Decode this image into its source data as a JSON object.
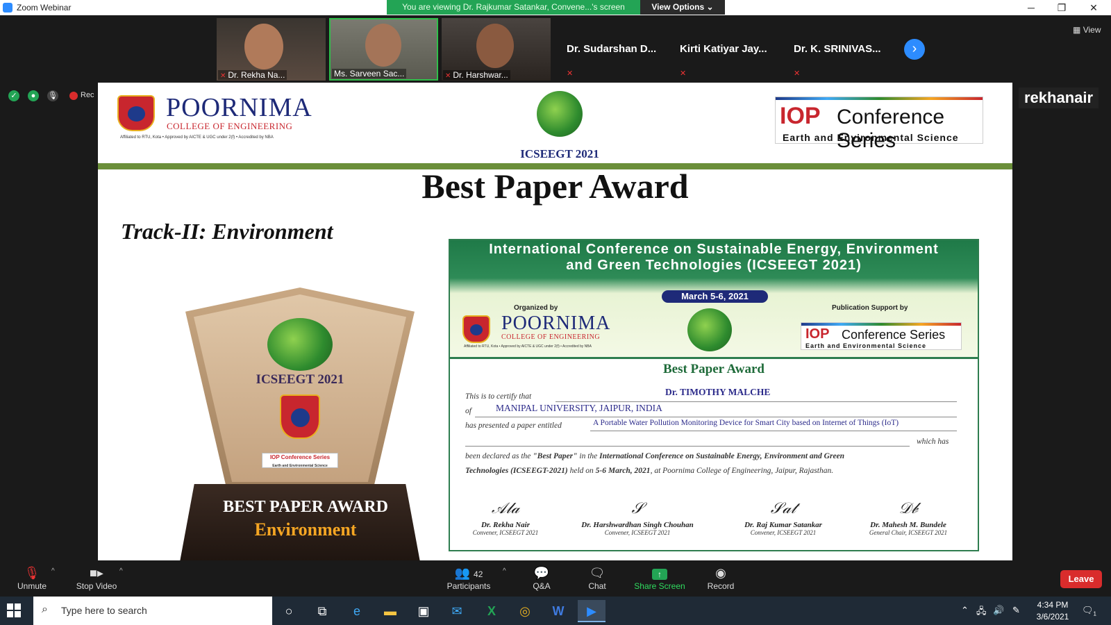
{
  "window": {
    "title": "Zoom Webinar",
    "viewing_banner": "You are viewing Dr. Rajkumar Satankar, Convene...'s screen",
    "view_options": "View Options"
  },
  "participants_strip": {
    "video_tiles": [
      {
        "label": "Dr. Rekha Na..."
      },
      {
        "label": "Ms. Sarveen Sac..."
      },
      {
        "label": "Dr. Harshwar..."
      }
    ],
    "name_tiles": [
      {
        "name": "Dr. Sudarshan D..."
      },
      {
        "name": "Kirti Katiyar Jay..."
      },
      {
        "name": "Dr. K. SRINIVAS..."
      }
    ],
    "view_label": "View"
  },
  "status": {
    "record_label": "Rec"
  },
  "shared_screen": {
    "sharer_name": "rekhanair",
    "header": {
      "college_name": "POORNIMA",
      "college_sub": "COLLEGE OF ENGINEERING",
      "college_aff": "Affiliated to RTU, Kota • Approved by AICTE & UGC under 2(f) • Accredited by NBA",
      "conf_short": "ICSEEGT 2021",
      "iop_big": "IOP",
      "iop_cs": "Conference Series",
      "iop_ees": "Earth and Environmental Science"
    },
    "award_title": "Best Paper Award",
    "track": "Track-II: Environment",
    "trophy": {
      "year": "ICSEEGT 2021",
      "award": "BEST PAPER AWARD",
      "track": "Environment",
      "iop_small": "IOP Conference Series",
      "iop_tiny": "Earth and Environmental Science"
    },
    "certificate": {
      "conf_name": "International Conference on Sustainable Energy, Environment and Green Technologies (ICSEEGT 2021)",
      "dates": "March 5-6, 2021",
      "organized_by": "Organized by",
      "publication_support": "Publication Support by",
      "heading": "Best Paper Award",
      "certify_text": "This is to certify that",
      "recipient": "Dr. TIMOTHY MALCHE",
      "of_text": "of",
      "institution": "MANIPAL UNIVERSITY, JAIPUR, INDIA",
      "presented_text": "has presented a paper entitled",
      "paper_title": "A Portable Water Pollution Monitoring Device for Smart City based on Internet of Things (IoT)",
      "which_has": "which has",
      "line1_a": "been declared as the ",
      "best_paper": "\"Best Paper\"",
      "line1_b": " in the ",
      "conf_bold": "International Conference on Sustainable Energy, Environment and Green",
      "line2_bold": "Technologies (ICSEEGT-2021)",
      "line2_a": " held on ",
      "line2_date": "5-6 March, 2021",
      "line2_b": ", at Poornima College of Engineering, Jaipur, Rajasthan.",
      "signatories": [
        {
          "name": "Dr. Rekha Nair",
          "role": "Convener, ICSEEGT 2021"
        },
        {
          "name": "Dr. Harshwardhan Singh Chouhan",
          "role": "Convener, ICSEEGT 2021"
        },
        {
          "name": "Dr. Raj Kumar Satankar",
          "role": "Convener, ICSEEGT 2021"
        },
        {
          "name": "Dr. Mahesh M. Bundele",
          "role": "General Chair, ICSEEGT 2021"
        }
      ]
    }
  },
  "toolbar": {
    "unmute": "Unmute",
    "stop_video": "Stop Video",
    "participants": "Participants",
    "participant_count": "42",
    "qa": "Q&A",
    "chat": "Chat",
    "share_screen": "Share Screen",
    "record": "Record",
    "leave": "Leave"
  },
  "taskbar": {
    "search_placeholder": "Type here to search",
    "time": "4:34 PM",
    "date": "3/6/2021",
    "notification_count": "1"
  }
}
